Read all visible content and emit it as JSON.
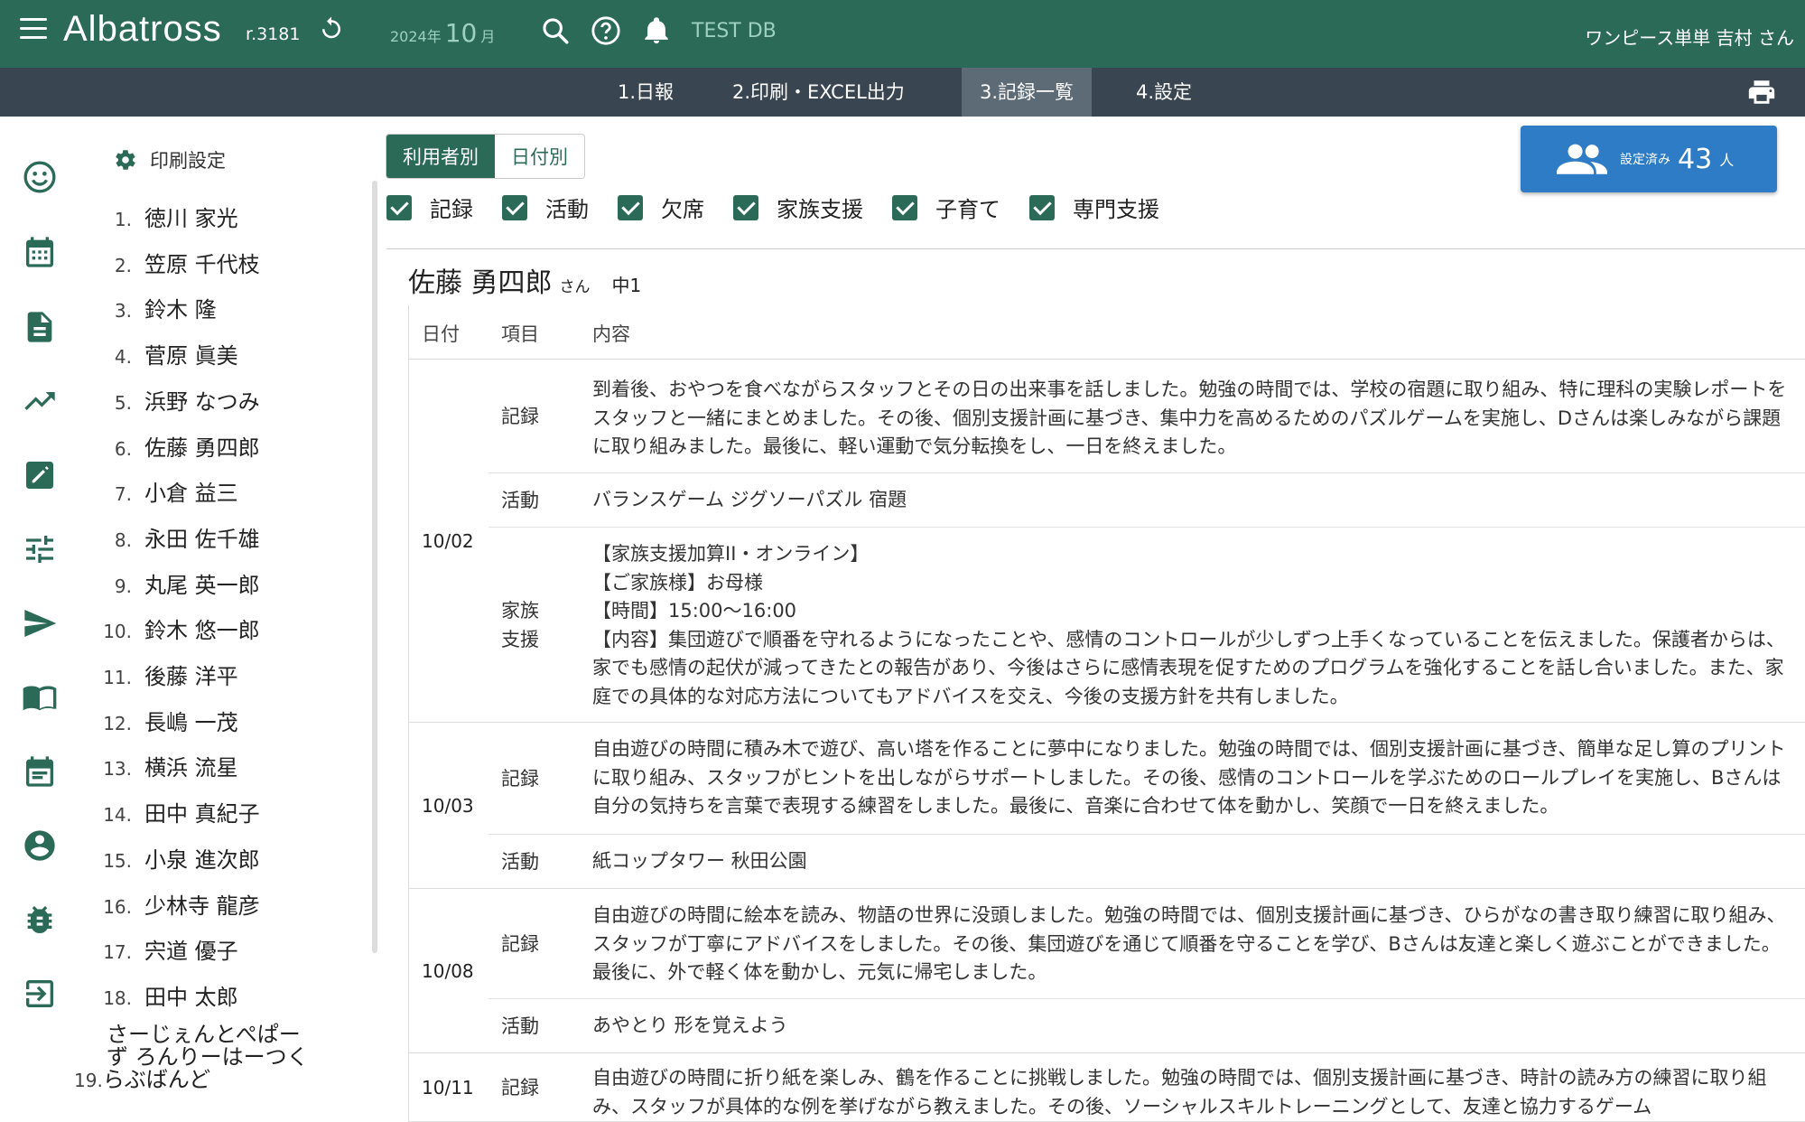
{
  "topbar": {
    "brand": "Albatross",
    "version": "r.3181",
    "year": "2024年",
    "month": "10",
    "month_unit": "月",
    "db": "TEST DB",
    "user": "ワンピース単単 吉村 さん"
  },
  "nav": {
    "tabs": [
      {
        "label": "1.日報"
      },
      {
        "label": "2.印刷・EXCEL出力"
      },
      {
        "label": "3.記録一覧"
      },
      {
        "label": "4.設定"
      }
    ],
    "active": "3.記録一覧"
  },
  "rail": [
    "smile-icon",
    "calendar-icon",
    "document-icon",
    "trend-icon",
    "edit-icon",
    "tune-icon",
    "send-icon",
    "book-icon",
    "event-icon",
    "account-icon",
    "bug-icon",
    "logout-icon"
  ],
  "roster": {
    "settings_label": "印刷設定",
    "items": [
      {
        "num": "1.",
        "name": "徳川 家光"
      },
      {
        "num": "2.",
        "name": "笠原 千代枝"
      },
      {
        "num": "3.",
        "name": "鈴木 隆"
      },
      {
        "num": "4.",
        "name": "菅原 眞美"
      },
      {
        "num": "5.",
        "name": "浜野 なつみ"
      },
      {
        "num": "6.",
        "name": "佐藤 勇四郎"
      },
      {
        "num": "7.",
        "name": "小倉 益三"
      },
      {
        "num": "8.",
        "name": "永田 佐千雄"
      },
      {
        "num": "9.",
        "name": "丸尾 英一郎"
      },
      {
        "num": "10.",
        "name": "鈴木 悠一郎"
      },
      {
        "num": "11.",
        "name": "後藤 洋平"
      },
      {
        "num": "12.",
        "name": "長嶋 一茂"
      },
      {
        "num": "13.",
        "name": "横浜 流星"
      },
      {
        "num": "14.",
        "name": "田中 真紀子"
      },
      {
        "num": "15.",
        "name": "小泉 進次郎"
      },
      {
        "num": "16.",
        "name": "少林寺 龍彦"
      },
      {
        "num": "17.",
        "name": "宍道 優子"
      },
      {
        "num": "18.",
        "name": "田中 太郎"
      }
    ],
    "item19": {
      "line1": "さーじぇんとぺぱー",
      "line2": "ず ろんりーはーつく",
      "num": "19.",
      "line3": "らぶばんど"
    }
  },
  "view_toggle": {
    "by_user": "利用者別",
    "by_date": "日付別"
  },
  "filters": [
    {
      "label": "記録",
      "checked": true
    },
    {
      "label": "活動",
      "checked": true
    },
    {
      "label": "欠席",
      "checked": true
    },
    {
      "label": "家族支援",
      "checked": true
    },
    {
      "label": "子育て",
      "checked": true
    },
    {
      "label": "専門支援",
      "checked": true
    }
  ],
  "summary": {
    "label": "設定済み",
    "count": "43",
    "unit": "人"
  },
  "person": {
    "name": "佐藤 勇四郎",
    "honorific": "さん",
    "grade": "中1"
  },
  "table": {
    "headers": {
      "date": "日付",
      "item": "項目",
      "content": "内容"
    },
    "groups": [
      {
        "date": "10/02",
        "rows": [
          {
            "cat": "記録",
            "text": "到着後、おやつを食べながらスタッフとその日の出来事を話しました。勉強の時間では、学校の宿題に取り組み、特に理科の実験レポートをスタッフと一緒にまとめました。その後、個別支援計画に基づき、集中力を高めるためのパズルゲームを実施し、Dさんは楽しみながら課題に取り組みました。最後に、軽い運動で気分転換をし、一日を終えました。"
          },
          {
            "cat": "活動",
            "text": "バランスゲーム ジグソーパズル 宿題"
          },
          {
            "cat": "家族\n支援",
            "text": "【家族支援加算II・オンライン】\n【ご家族様】お母様\n【時間】15:00〜16:00\n【内容】集団遊びで順番を守れるようになったことや、感情のコントロールが少しずつ上手くなっていることを伝えました。保護者からは、家でも感情の起伏が減ってきたとの報告があり、今後はさらに感情表現を促すためのプログラムを強化することを話し合いました。また、家庭での具体的な対応方法についてもアドバイスを交え、今後の支援方針を共有しました。"
          }
        ]
      },
      {
        "date": "10/03",
        "rows": [
          {
            "cat": "記録",
            "text": "自由遊びの時間に積み木で遊び、高い塔を作ることに夢中になりました。勉強の時間では、個別支援計画に基づき、簡単な足し算のプリントに取り組み、スタッフがヒントを出しながらサポートしました。その後、感情のコントロールを学ぶためのロールプレイを実施し、Bさんは自分の気持ちを言葉で表現する練習をしました。最後に、音楽に合わせて体を動かし、笑顔で一日を終えました。"
          },
          {
            "cat": "活動",
            "text": "紙コップタワー 秋田公園"
          }
        ]
      },
      {
        "date": "10/08",
        "rows": [
          {
            "cat": "記録",
            "text": "自由遊びの時間に絵本を読み、物語の世界に没頭しました。勉強の時間では、個別支援計画に基づき、ひらがなの書き取り練習に取り組み、スタッフが丁寧にアドバイスをしました。その後、集団遊びを通じて順番を守ることを学び、Bさんは友達と楽しく遊ぶことができました。最後に、外で軽く体を動かし、元気に帰宅しました。"
          },
          {
            "cat": "活動",
            "text": "あやとり 形を覚えよう"
          }
        ]
      },
      {
        "date": "10/11",
        "rows": [
          {
            "cat": "記録",
            "text": "自由遊びの時間に折り紙を楽しみ、鶴を作ることに挑戦しました。勉強の時間では、個別支援計画に基づき、時計の読み方の練習に取り組み、スタッフが具体的な例を挙げながら教えました。その後、ソーシャルスキルトレーニングとして、友達と協力するゲーム"
          }
        ]
      }
    ]
  },
  "colors": {
    "primary": "#2c6a58",
    "nav": "#394550",
    "accent": "#2e7cc6"
  }
}
